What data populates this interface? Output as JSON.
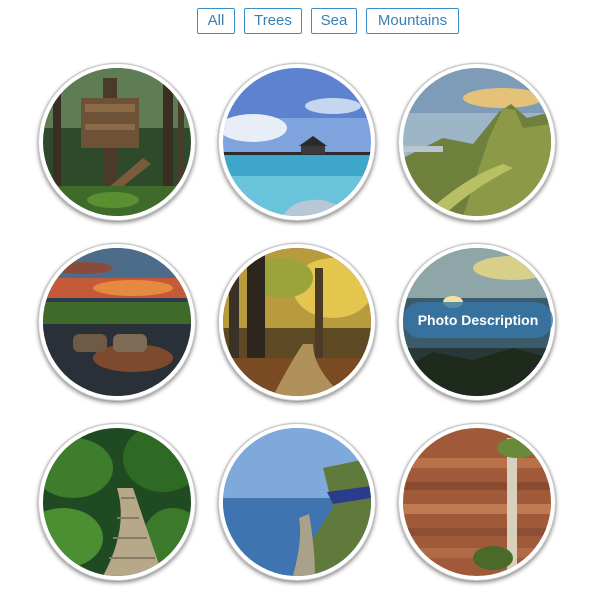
{
  "filters": [
    {
      "label": "All"
    },
    {
      "label": "Trees"
    },
    {
      "label": "Sea"
    },
    {
      "label": "Mountains"
    }
  ],
  "gallery": {
    "items": [
      {
        "subject": "treehouse-in-forest"
      },
      {
        "subject": "pier-over-sea"
      },
      {
        "subject": "green-mountains"
      },
      {
        "subject": "sunset-lake"
      },
      {
        "subject": "autumn-forest-path"
      },
      {
        "subject": "sea-sunset",
        "caption": "Photo Description"
      },
      {
        "subject": "fern-boardwalk"
      },
      {
        "subject": "coastal-railway"
      },
      {
        "subject": "red-rock-cliff"
      }
    ]
  },
  "colors": {
    "accent": "#3a8fc6",
    "button_text": "#3a7fb4",
    "caption_bg": "#3778aa"
  }
}
